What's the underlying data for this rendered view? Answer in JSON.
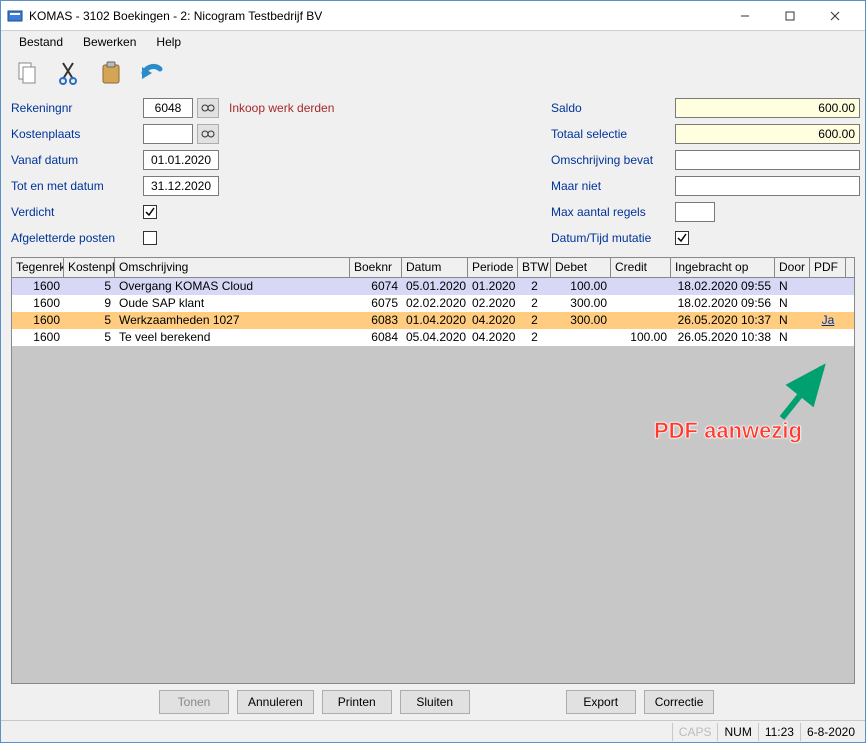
{
  "title": "KOMAS - 3102 Boekingen - 2: Nicogram Testbedrijf BV",
  "menu": {
    "bestand": "Bestand",
    "bewerken": "Bewerken",
    "help": "Help"
  },
  "form": {
    "rekeningnr_label": "Rekeningnr",
    "rekeningnr_value": "6048",
    "rekeningnr_desc": "Inkoop werk derden",
    "kostenplaats_label": "Kostenplaats",
    "kostenplaats_value": "",
    "vanaf_label": "Vanaf datum",
    "vanaf_value": "01.01.2020",
    "tot_label": "Tot en met datum",
    "tot_value": "31.12.2020",
    "verdicht_label": "Verdicht",
    "verdicht_checked": true,
    "afgeletterde_label": "Afgeletterde posten",
    "afgeletterde_checked": false,
    "saldo_label": "Saldo",
    "saldo_value": "600.00",
    "totaal_label": "Totaal selectie",
    "totaal_value": "600.00",
    "omschrijving_label": "Omschrijving bevat",
    "omschrijving_value": "",
    "maarniet_label": "Maar niet",
    "maarniet_value": "",
    "max_label": "Max aantal regels",
    "max_value": "",
    "datumtijd_label": "Datum/Tijd mutatie",
    "datumtijd_checked": true
  },
  "grid": {
    "headers": {
      "tegenrek": "Tegenrek",
      "kostenpl": "Kostenpl",
      "omschrijving": "Omschrijving",
      "boeknr": "Boeknr",
      "datum": "Datum",
      "periode": "Periode",
      "btw": "BTW",
      "debet": "Debet",
      "credit": "Credit",
      "ingebracht": "Ingebracht op",
      "door": "Door",
      "pdf": "PDF"
    },
    "rows": [
      {
        "tegenrek": "1600",
        "kostenpl": "5",
        "oms": "Overgang KOMAS Cloud",
        "boeknr": "6074",
        "datum": "05.01.2020",
        "periode": "01.2020",
        "btw": "2",
        "debet": "100.00",
        "credit": "",
        "ing": "18.02.2020 09:55",
        "door": "N",
        "pdf": ""
      },
      {
        "tegenrek": "1600",
        "kostenpl": "9",
        "oms": "Oude SAP klant",
        "boeknr": "6075",
        "datum": "02.02.2020",
        "periode": "02.2020",
        "btw": "2",
        "debet": "300.00",
        "credit": "",
        "ing": "18.02.2020 09:56",
        "door": "N",
        "pdf": ""
      },
      {
        "tegenrek": "1600",
        "kostenpl": "5",
        "oms": "Werkzaamheden 1027",
        "boeknr": "6083",
        "datum": "01.04.2020",
        "periode": "04.2020",
        "btw": "2",
        "debet": "300.00",
        "credit": "",
        "ing": "26.05.2020 10:37",
        "door": "N",
        "pdf": "Ja"
      },
      {
        "tegenrek": "1600",
        "kostenpl": "5",
        "oms": "Te veel berekend",
        "boeknr": "6084",
        "datum": "05.04.2020",
        "periode": "04.2020",
        "btw": "2",
        "debet": "",
        "credit": "100.00",
        "ing": "26.05.2020 10:38",
        "door": "N",
        "pdf": ""
      }
    ]
  },
  "overlay": {
    "text": "PDF aanwezig"
  },
  "buttons": {
    "tonen": "Tonen",
    "annuleren": "Annuleren",
    "printen": "Printen",
    "sluiten": "Sluiten",
    "export": "Export",
    "correctie": "Correctie"
  },
  "status": {
    "caps": "CAPS",
    "num": "NUM",
    "time": "11:23",
    "date": "6-8-2020"
  }
}
